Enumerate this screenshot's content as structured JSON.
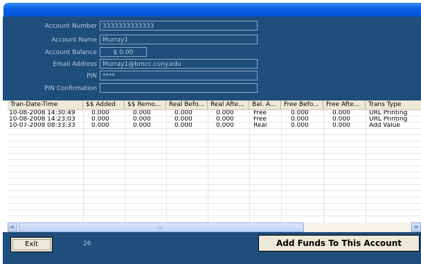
{
  "window": {
    "title": ""
  },
  "form": {
    "account_number": {
      "label": "Account Number",
      "value": "3333333333333"
    },
    "account_name": {
      "label": "Account Name",
      "value": "Murray1"
    },
    "account_balance": {
      "label": "Account Balance",
      "value": "$ 0.00"
    },
    "email": {
      "label": "Email Address",
      "value": "Murray1@bmcc.cuny.edu"
    },
    "pin": {
      "label": "PIN",
      "value": "****"
    },
    "pin_confirmation": {
      "label": "PIN Confirmation",
      "value": ""
    }
  },
  "grid": {
    "columns": [
      "Tran-Date-Time",
      "$$ Added",
      "$$ Remo...",
      "Real Befo...",
      "Real Afte...",
      "Bal. A...",
      "Free Befo...",
      "Free Afte...",
      "Trans Type"
    ],
    "rows": [
      [
        "10-08-2008  14:30:49",
        "0.000",
        "0.000",
        "0.000",
        "0.000",
        "Free",
        "0.000",
        "0.000",
        "URL Printing"
      ],
      [
        "10-08-2008  14:23:03",
        "0.000",
        "0.000",
        "0.000",
        "0.000",
        "Free",
        "0.000",
        "0.000",
        "URL Printing"
      ],
      [
        "10-07-2008  08:33:33",
        "0.000",
        "0.000",
        "0.000",
        "0.000",
        "Real",
        "0.000",
        "0.000",
        "Add Value"
      ]
    ]
  },
  "scrollbar": {
    "left_arrow": "<",
    "right_arrow": ">",
    "grip": "|||"
  },
  "footer": {
    "exit_label": "Exit",
    "count": "26",
    "add_funds_label": "Add Funds To This Account"
  },
  "colors": {
    "titlebar": "#0553d8",
    "panel": "#1f4e7c",
    "label_text": "#b5c6d8",
    "button_face": "#ece9d8"
  }
}
